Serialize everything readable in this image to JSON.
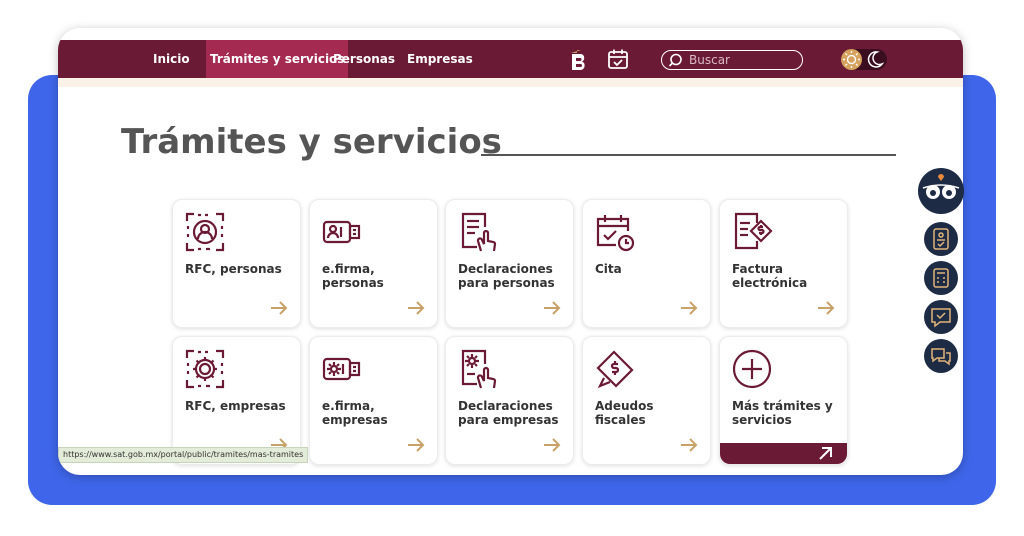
{
  "nav": {
    "items": [
      {
        "label": "Inicio",
        "active": false
      },
      {
        "label": "Trámites y servicios",
        "active": true
      },
      {
        "label": "Personas",
        "active": false
      },
      {
        "label": "Empresas",
        "active": false
      }
    ],
    "search_placeholder": "Buscar",
    "icons": [
      "brand-logo-icon",
      "calendar-icon",
      "search-icon",
      "sun-icon",
      "moon-icon"
    ]
  },
  "page": {
    "title": "Trámites y servicios"
  },
  "cards": [
    {
      "label": "RFC, personas",
      "icon": "rfc-person-icon"
    },
    {
      "label": "e.firma, personas",
      "icon": "efirma-usb-icon"
    },
    {
      "label": "Declaraciones para personas",
      "icon": "declaration-document-icon"
    },
    {
      "label": "Cita",
      "icon": "calendar-check-icon"
    },
    {
      "label": "Factura electrónica",
      "icon": "invoice-icon"
    },
    {
      "label": "RFC, empresas",
      "icon": "rfc-gear-icon"
    },
    {
      "label": "e.firma, empresas",
      "icon": "efirma-usb-gear-icon"
    },
    {
      "label": "Declaraciones para empresas",
      "icon": "declaration-gear-icon"
    },
    {
      "label": "Adeudos fiscales",
      "icon": "debt-money-icon"
    },
    {
      "label": "Más trámites y servicios",
      "icon": "plus-circle-icon"
    }
  ],
  "status_url": "https://www.sat.gob.mx/portal/public/tramites/mas-tramites",
  "colors": {
    "brand": "#6b1a36",
    "active_tab": "#a52a52",
    "accent_arrow": "#c8a168",
    "background_panel": "#3f66ea",
    "fab": "#1d2b44"
  },
  "side_buttons": [
    "assistant-owl-icon",
    "id-badge-icon",
    "calculator-icon",
    "feedback-check-icon",
    "chat-icon"
  ]
}
